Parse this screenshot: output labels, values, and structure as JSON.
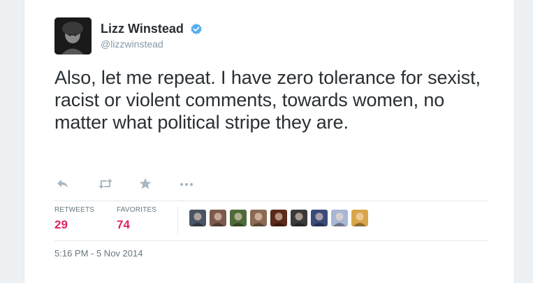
{
  "user": {
    "name": "Lizz Winstead",
    "handle": "@lizzwinstead"
  },
  "tweet": {
    "text": "Also, let me repeat. I have zero tolerance for sexist, racist or violent comments, towards women, no matter what political stripe they are."
  },
  "actions": {
    "reply_icon": "reply-icon",
    "retweet_icon": "retweet-icon",
    "favorite_icon": "star-icon",
    "more_icon": "more-icon"
  },
  "stats": {
    "retweets_label": "RETWEETS",
    "retweets_count": "29",
    "favorites_label": "FAVORITES",
    "favorites_count": "74"
  },
  "faces": [
    {
      "name": "favoriter-avatar-1",
      "color": "#4a5563"
    },
    {
      "name": "favoriter-avatar-2",
      "color": "#7a5a4a"
    },
    {
      "name": "favoriter-avatar-3",
      "color": "#4f6a3a"
    },
    {
      "name": "favoriter-avatar-4",
      "color": "#8a6a52"
    },
    {
      "name": "favoriter-avatar-5",
      "color": "#5a2a1a"
    },
    {
      "name": "favoriter-avatar-6",
      "color": "#3a3a3a"
    },
    {
      "name": "favoriter-avatar-7",
      "color": "#3b4a7a"
    },
    {
      "name": "favoriter-avatar-8",
      "color": "#a7b7d4"
    },
    {
      "name": "favoriter-avatar-9",
      "color": "#d8a64a"
    }
  ],
  "timestamp": "5:16 PM - 5 Nov 2014",
  "colors": {
    "text": "#292f33",
    "muted": "#66757f",
    "count": "#e0245e",
    "verified": "#55acee",
    "icon": "#aab8c2"
  }
}
